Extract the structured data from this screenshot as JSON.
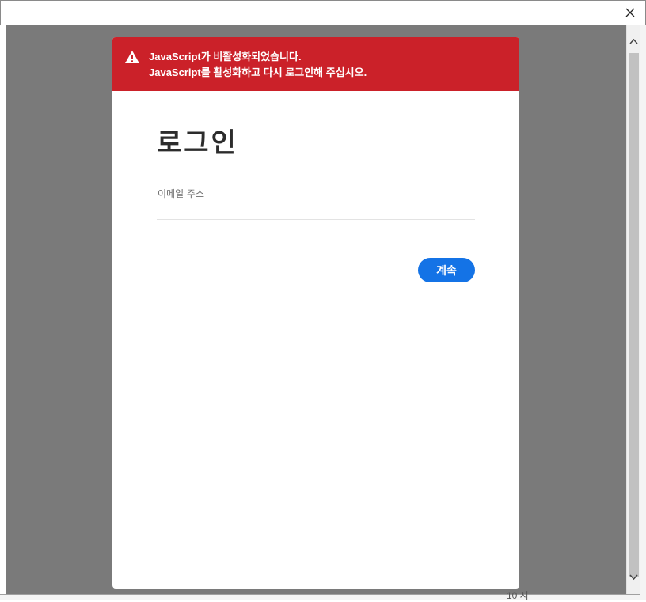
{
  "window": {
    "close_icon": "close-icon"
  },
  "alert": {
    "icon": "warning-icon",
    "line1": "JavaScript가 비활성화되었습니다.",
    "line2": "JavaScript를 활성화하고 다시 로그인해 주십시오.",
    "color": "#cb2129"
  },
  "login": {
    "title": "로그인",
    "email_label": "이메일 주소",
    "email_value": "",
    "continue_label": "계속",
    "accent": "#1473e6"
  },
  "background": {
    "partial_text": "10 시"
  }
}
